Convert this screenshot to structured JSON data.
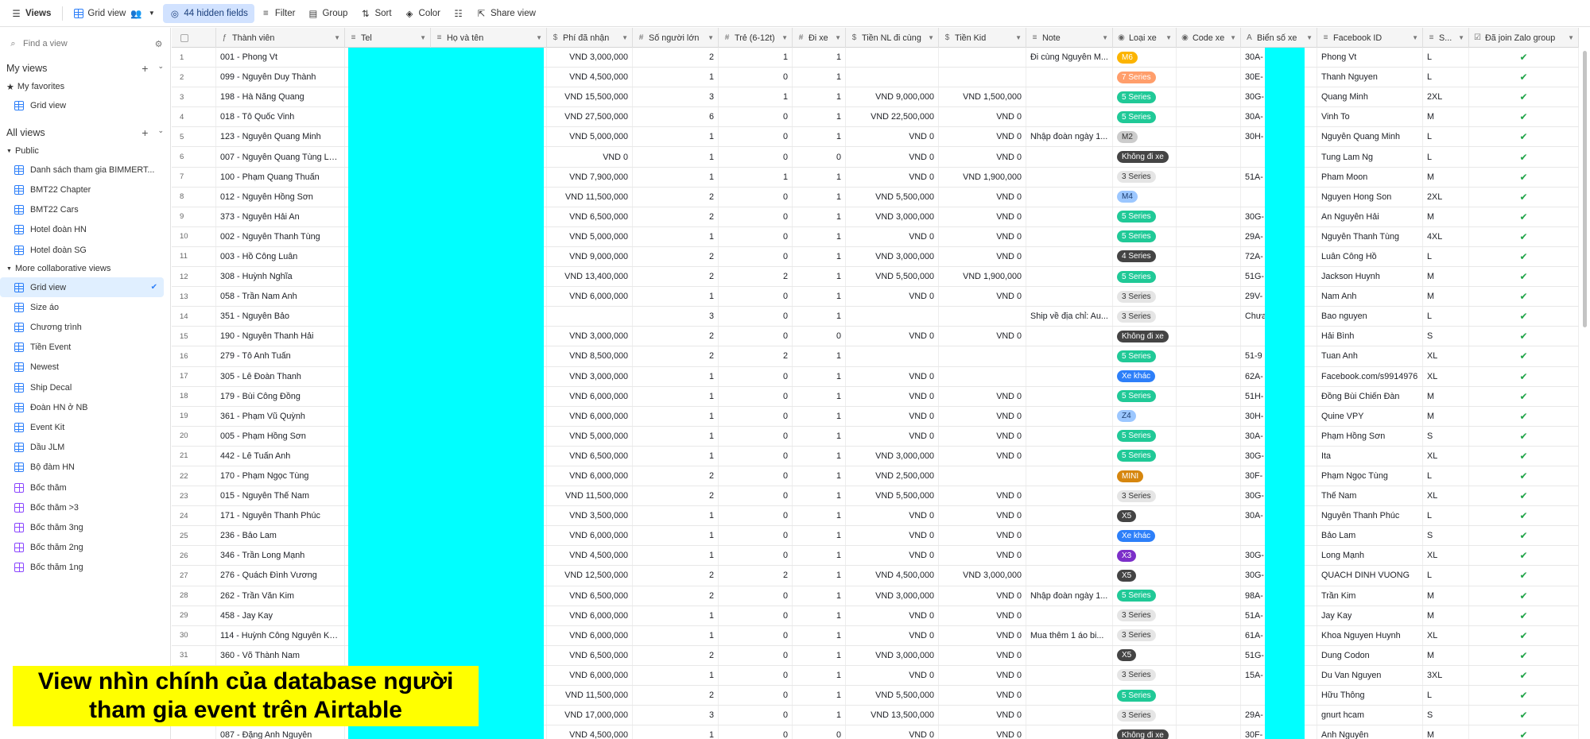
{
  "toolbar": {
    "views_label": "Views",
    "view_name": "Grid view",
    "hidden_fields": "44 hidden fields",
    "filter": "Filter",
    "group": "Group",
    "sort": "Sort",
    "color": "Color",
    "share": "Share view"
  },
  "sidebar": {
    "find_placeholder": "Find a view",
    "my_views": "My views",
    "my_favorites": "My favorites",
    "favorites": [
      {
        "label": "Grid view",
        "type": "grid"
      }
    ],
    "all_views": "All views",
    "public": "Public",
    "public_views": [
      {
        "label": "Danh sách tham gia BIMMERT...",
        "type": "grid"
      },
      {
        "label": "BMT22 Chapter",
        "type": "grid"
      },
      {
        "label": "BMT22 Cars",
        "type": "grid"
      },
      {
        "label": "Hotel đoàn HN",
        "type": "grid"
      },
      {
        "label": "Hotel đoàn SG",
        "type": "grid"
      }
    ],
    "more_collab": "More collaborative views",
    "collab_views": [
      {
        "label": "Grid view",
        "type": "grid",
        "active": true
      },
      {
        "label": "Size áo",
        "type": "grid"
      },
      {
        "label": "Chương trình",
        "type": "grid"
      },
      {
        "label": "Tiền Event",
        "type": "grid"
      },
      {
        "label": "Newest",
        "type": "grid"
      },
      {
        "label": "Ship Decal",
        "type": "grid"
      },
      {
        "label": "Đoàn HN ở NB",
        "type": "grid"
      },
      {
        "label": "Event Kit",
        "type": "grid"
      },
      {
        "label": "Dầu JLM",
        "type": "grid"
      },
      {
        "label": "Bộ đàm HN",
        "type": "grid"
      },
      {
        "label": "Bốc thăm",
        "type": "gallery"
      },
      {
        "label": "Bốc thăm >3",
        "type": "gallery"
      },
      {
        "label": "Bốc thăm 3ng",
        "type": "gallery"
      },
      {
        "label": "Bốc thăm 2ng",
        "type": "gallery"
      },
      {
        "label": "Bốc thăm 1ng",
        "type": "gallery"
      }
    ]
  },
  "columns": [
    {
      "label": "",
      "key": "chk",
      "width": 56,
      "kind": "idx"
    },
    {
      "label": "Thành viên",
      "key": "member",
      "width": 162,
      "icon": "formula-icon",
      "glyph": "ƒ"
    },
    {
      "label": "Tel",
      "key": "tel",
      "width": 108,
      "icon": "text-icon",
      "glyph": "≡"
    },
    {
      "label": "Họ và tên",
      "key": "fullname",
      "width": 146,
      "icon": "text-icon",
      "glyph": "≡"
    },
    {
      "label": "Phí đã nhận",
      "key": "fee",
      "width": 108,
      "icon": "currency-icon",
      "glyph": "$",
      "num": true
    },
    {
      "label": "Số người lớn",
      "key": "adults",
      "width": 108,
      "icon": "number-icon",
      "glyph": "#",
      "num": true
    },
    {
      "label": "Trẻ (6-12t)",
      "key": "kids",
      "width": 93,
      "icon": "number-icon",
      "glyph": "#",
      "num": true
    },
    {
      "label": "Đi xe",
      "key": "car",
      "width": 67,
      "icon": "number-icon",
      "glyph": "#",
      "num": true
    },
    {
      "label": "Tiền NL đi cùng",
      "key": "adultfee",
      "width": 117,
      "icon": "currency-icon",
      "glyph": "$",
      "num": true
    },
    {
      "label": "Tiền Kid",
      "key": "kidfee",
      "width": 110,
      "icon": "currency-icon",
      "glyph": "$",
      "num": true
    },
    {
      "label": "Note",
      "key": "note",
      "width": 109,
      "icon": "text-icon",
      "glyph": "≡"
    },
    {
      "label": "Loại xe",
      "key": "cartype",
      "width": 80,
      "icon": "select-icon",
      "glyph": "◉"
    },
    {
      "label": "Code xe",
      "key": "code",
      "width": 81,
      "icon": "select-icon",
      "glyph": "◉"
    },
    {
      "label": "Biển số xe",
      "key": "plate",
      "width": 96,
      "icon": "text-icon",
      "glyph": "A"
    },
    {
      "label": "Facebook ID",
      "key": "fb",
      "width": 133,
      "icon": "text-icon",
      "glyph": "≡"
    },
    {
      "label": "S...",
      "key": "size",
      "width": 58,
      "icon": "text-icon",
      "glyph": "≡"
    },
    {
      "label": "Đã join Zalo group",
      "key": "zalo",
      "width": 138,
      "icon": "checkbox-icon",
      "glyph": "☑",
      "check": true
    }
  ],
  "cartype_colors": {
    "M6": [
      "#fcb400",
      "#fff"
    ],
    "7 Series": [
      "#ff9e6b",
      "#fff"
    ],
    "5 Series": [
      "#20c997",
      "#fff"
    ],
    "M2": [
      "#cccccc",
      "#333"
    ],
    "Không đi xe": [
      "#444444",
      "#fff"
    ],
    "3 Series": [
      "#e5e5e5",
      "#333"
    ],
    "M4": [
      "#9cc7ff",
      "#1d3e70"
    ],
    "4 Series": [
      "#444444",
      "#fff"
    ],
    "Xe khác": [
      "#2d7ff9",
      "#fff"
    ],
    "Z4": [
      "#9cc7ff",
      "#1d3e70"
    ],
    "MINI": [
      "#d6860e",
      "#fff"
    ],
    "X5": [
      "#444444",
      "#fff"
    ],
    "X3": [
      "#7c2fc9",
      "#fff"
    ]
  },
  "rows": [
    {
      "idx": "1",
      "member": "001 - Phong Vt",
      "fee": "VND 3,000,000",
      "adults": "2",
      "kids": "1",
      "car": "1",
      "adultfee": "",
      "kidfee": "",
      "note": "Đi cùng Nguyễn M...",
      "cartype": "M6",
      "code": "",
      "plate": "30A-",
      "fb": "Phong Vt",
      "size": "L",
      "zalo": true
    },
    {
      "idx": "2",
      "member": "099 - Nguyễn Duy Thành",
      "fee": "VND 4,500,000",
      "adults": "1",
      "kids": "0",
      "car": "1",
      "adultfee": "",
      "kidfee": "",
      "note": "",
      "cartype": "7 Series",
      "code": "",
      "plate": "30E-",
      "fb": "Thanh Nguyen",
      "size": "L",
      "zalo": true
    },
    {
      "idx": "3",
      "member": "198 - Hà Năng Quang",
      "fee": "VND 15,500,000",
      "adults": "3",
      "kids": "1",
      "car": "1",
      "adultfee": "VND 9,000,000",
      "kidfee": "VND 1,500,000",
      "note": "",
      "cartype": "5 Series",
      "code": "",
      "plate": "30G-",
      "fb": "Quang Minh",
      "size": "2XL",
      "zalo": true
    },
    {
      "idx": "4",
      "member": "018 - Tô Quốc Vinh",
      "fee": "VND 27,500,000",
      "adults": "6",
      "kids": "0",
      "car": "1",
      "adultfee": "VND 22,500,000",
      "kidfee": "VND 0",
      "note": "",
      "cartype": "5 Series",
      "code": "",
      "plate": "30A-",
      "fb": "Vinh To",
      "size": "M",
      "zalo": true
    },
    {
      "idx": "5",
      "member": "123 - Nguyễn Quang Minh",
      "fee": "VND 5,000,000",
      "adults": "1",
      "kids": "0",
      "car": "1",
      "adultfee": "VND 0",
      "kidfee": "VND 0",
      "note": "Nhập đoàn ngày 1...",
      "cartype": "M2",
      "code": "",
      "plate": "30H-",
      "fb": "Nguyễn Quang Minh",
      "size": "L",
      "zalo": true
    },
    {
      "idx": "6",
      "member": "007 - Nguyễn Quang Tùng Lâm",
      "fee": "VND 0",
      "adults": "1",
      "kids": "0",
      "car": "0",
      "adultfee": "VND 0",
      "kidfee": "VND 0",
      "note": "",
      "cartype": "Không đi xe",
      "code": "",
      "plate": "",
      "fb": "Tung Lam Ng",
      "size": "L",
      "zalo": true
    },
    {
      "idx": "7",
      "member": "100 - Phạm Quang Thuấn",
      "fee": "VND 7,900,000",
      "adults": "1",
      "kids": "1",
      "car": "1",
      "adultfee": "VND 0",
      "kidfee": "VND 1,900,000",
      "note": "",
      "cartype": "3 Series",
      "code": "",
      "plate": "51A-",
      "fb": "Pham Moon",
      "size": "M",
      "zalo": true
    },
    {
      "idx": "8",
      "member": "012 - Nguyễn Hồng Sơn",
      "fee": "VND 11,500,000",
      "adults": "2",
      "kids": "0",
      "car": "1",
      "adultfee": "VND 5,500,000",
      "kidfee": "VND 0",
      "note": "",
      "cartype": "M4",
      "code": "",
      "plate": "",
      "fb": "Nguyen Hong Son",
      "size": "2XL",
      "zalo": true
    },
    {
      "idx": "9",
      "member": "373 - Nguyễn Hải An",
      "fee": "VND 6,500,000",
      "adults": "2",
      "kids": "0",
      "car": "1",
      "adultfee": "VND 3,000,000",
      "kidfee": "VND 0",
      "note": "",
      "cartype": "5 Series",
      "code": "",
      "plate": "30G-",
      "fb": "An Nguyễn Hải",
      "size": "M",
      "zalo": true
    },
    {
      "idx": "10",
      "member": "002 - Nguyễn Thanh Tùng",
      "fee": "VND 5,000,000",
      "adults": "1",
      "kids": "0",
      "car": "1",
      "adultfee": "VND 0",
      "kidfee": "VND 0",
      "note": "",
      "cartype": "5 Series",
      "code": "",
      "plate": "29A-",
      "fb": "Nguyễn Thanh Tùng",
      "size": "4XL",
      "zalo": true
    },
    {
      "idx": "11",
      "member": "003 - Hồ Công Luân",
      "fee": "VND 9,000,000",
      "adults": "2",
      "kids": "0",
      "car": "1",
      "adultfee": "VND 3,000,000",
      "kidfee": "VND 0",
      "note": "",
      "cartype": "4 Series",
      "code": "",
      "plate": "72A-",
      "fb": "Luân Công Hồ",
      "size": "L",
      "zalo": true
    },
    {
      "idx": "12",
      "member": "308 - Huỳnh Nghĩa",
      "fee": "VND 13,400,000",
      "adults": "2",
      "kids": "2",
      "car": "1",
      "adultfee": "VND 5,500,000",
      "kidfee": "VND 1,900,000",
      "note": "",
      "cartype": "5 Series",
      "code": "",
      "plate": "51G-",
      "fb": "Jackson Huynh",
      "size": "M",
      "zalo": true
    },
    {
      "idx": "13",
      "member": "058 - Trần Nam Anh",
      "fee": "VND 6,000,000",
      "adults": "1",
      "kids": "0",
      "car": "1",
      "adultfee": "VND 0",
      "kidfee": "VND 0",
      "note": "",
      "cartype": "3 Series",
      "code": "",
      "plate": "29V-",
      "fb": "Nam Anh",
      "size": "M",
      "zalo": true
    },
    {
      "idx": "14",
      "member": "351 - Nguyễn Bảo",
      "fee": "",
      "adults": "3",
      "kids": "0",
      "car": "1",
      "adultfee": "",
      "kidfee": "",
      "note": "Ship về địa chỉ: Au...",
      "cartype": "3 Series",
      "code": "",
      "plate": "Chưa",
      "fb": "Bao nguyen",
      "size": "L",
      "zalo": true
    },
    {
      "idx": "15",
      "member": "190 - Nguyễn Thanh Hải",
      "fee": "VND 3,000,000",
      "adults": "2",
      "kids": "0",
      "car": "0",
      "adultfee": "VND 0",
      "kidfee": "VND 0",
      "note": "",
      "cartype": "Không đi xe",
      "code": "",
      "plate": "",
      "fb": "Hải Bình",
      "size": "S",
      "zalo": true
    },
    {
      "idx": "16",
      "member": "279 - Tô Anh Tuấn",
      "fee": "VND 8,500,000",
      "adults": "2",
      "kids": "2",
      "car": "1",
      "adultfee": "",
      "kidfee": "",
      "note": "",
      "cartype": "5 Series",
      "code": "",
      "plate": "51-9",
      "fb": "Tuan Anh",
      "size": "XL",
      "zalo": true
    },
    {
      "idx": "17",
      "member": "305 - Lê Đoàn Thanh",
      "fee": "VND 3,000,000",
      "adults": "1",
      "kids": "0",
      "car": "1",
      "adultfee": "VND 0",
      "kidfee": "",
      "note": "",
      "cartype": "Xe khác",
      "code": "",
      "plate": "62A-",
      "fb": "Facebook.com/s9914976",
      "size": "XL",
      "zalo": true
    },
    {
      "idx": "18",
      "member": "179 - Bùi Công Đồng",
      "fee": "VND 6,000,000",
      "adults": "1",
      "kids": "0",
      "car": "1",
      "adultfee": "VND 0",
      "kidfee": "VND 0",
      "note": "",
      "cartype": "5 Series",
      "code": "",
      "plate": "51H-",
      "fb": "Đồng Bùi Chiến Đàn",
      "size": "M",
      "zalo": true
    },
    {
      "idx": "19",
      "member": "361 - Phạm Vũ Quỳnh",
      "fee": "VND 6,000,000",
      "adults": "1",
      "kids": "0",
      "car": "1",
      "adultfee": "VND 0",
      "kidfee": "VND 0",
      "note": "",
      "cartype": "Z4",
      "code": "",
      "plate": "30H-",
      "fb": "Quine VPY",
      "size": "M",
      "zalo": true
    },
    {
      "idx": "20",
      "member": "005 - Phạm Hồng Sơn",
      "fee": "VND 5,000,000",
      "adults": "1",
      "kids": "0",
      "car": "1",
      "adultfee": "VND 0",
      "kidfee": "VND 0",
      "note": "",
      "cartype": "5 Series",
      "code": "",
      "plate": "30A-",
      "fb": "Phạm Hồng Sơn",
      "size": "S",
      "zalo": true
    },
    {
      "idx": "21",
      "member": "442 - Lê Tuấn Anh",
      "fee": "VND 6,500,000",
      "adults": "1",
      "kids": "0",
      "car": "1",
      "adultfee": "VND 3,000,000",
      "kidfee": "VND 0",
      "note": "",
      "cartype": "5 Series",
      "code": "",
      "plate": "30G-",
      "fb": "Ita",
      "size": "XL",
      "zalo": true
    },
    {
      "idx": "22",
      "member": "170 - Phạm Ngọc Tùng",
      "fee": "VND 6,000,000",
      "adults": "2",
      "kids": "0",
      "car": "1",
      "adultfee": "VND 2,500,000",
      "kidfee": "",
      "note": "",
      "cartype": "MINI",
      "code": "",
      "plate": "30F-",
      "fb": "Phạm Ngọc Tùng",
      "size": "L",
      "zalo": true
    },
    {
      "idx": "23",
      "member": "015 - Nguyễn Thế Nam",
      "fee": "VND 11,500,000",
      "adults": "2",
      "kids": "0",
      "car": "1",
      "adultfee": "VND 5,500,000",
      "kidfee": "VND 0",
      "note": "",
      "cartype": "3 Series",
      "code": "",
      "plate": "30G-",
      "fb": "Thế Nam",
      "size": "XL",
      "zalo": true
    },
    {
      "idx": "24",
      "member": "171 - Nguyễn Thanh Phúc",
      "fee": "VND 3,500,000",
      "adults": "1",
      "kids": "0",
      "car": "1",
      "adultfee": "VND 0",
      "kidfee": "VND 0",
      "note": "",
      "cartype": "X5",
      "code": "",
      "plate": "30A-",
      "fb": "Nguyễn Thanh Phúc",
      "size": "L",
      "zalo": true
    },
    {
      "idx": "25",
      "member": "236 - Bảo Lam",
      "fee": "VND 6,000,000",
      "adults": "1",
      "kids": "0",
      "car": "1",
      "adultfee": "VND 0",
      "kidfee": "VND 0",
      "note": "",
      "cartype": "Xe khác",
      "code": "",
      "plate": "",
      "fb": "Bảo Lam",
      "size": "S",
      "zalo": true
    },
    {
      "idx": "26",
      "member": "346 - Trần Long Mạnh",
      "fee": "VND 4,500,000",
      "adults": "1",
      "kids": "0",
      "car": "1",
      "adultfee": "VND 0",
      "kidfee": "VND 0",
      "note": "",
      "cartype": "X3",
      "code": "",
      "plate": "30G-",
      "fb": "Long Mạnh",
      "size": "XL",
      "zalo": true
    },
    {
      "idx": "27",
      "member": "276 - Quách Đình Vương",
      "fee": "VND 12,500,000",
      "adults": "2",
      "kids": "2",
      "car": "1",
      "adultfee": "VND 4,500,000",
      "kidfee": "VND 3,000,000",
      "note": "",
      "cartype": "X5",
      "code": "",
      "plate": "30G-",
      "fb": "QUACH DINH VUONG",
      "size": "L",
      "zalo": true
    },
    {
      "idx": "28",
      "member": "262 - Trần Văn Kim",
      "fee": "VND 6,500,000",
      "adults": "2",
      "kids": "0",
      "car": "1",
      "adultfee": "VND 3,000,000",
      "kidfee": "VND 0",
      "note": "Nhập đoàn ngày 1...",
      "cartype": "5 Series",
      "code": "",
      "plate": "98A-",
      "fb": "Trần Kim",
      "size": "M",
      "zalo": true
    },
    {
      "idx": "29",
      "member": "458 - Jay Kay",
      "fee": "VND 6,000,000",
      "adults": "1",
      "kids": "0",
      "car": "1",
      "adultfee": "VND 0",
      "kidfee": "VND 0",
      "note": "",
      "cartype": "3 Series",
      "code": "",
      "plate": "51A-",
      "fb": "Jay Kay",
      "size": "M",
      "zalo": true
    },
    {
      "idx": "30",
      "member": "114 - Huỳnh Công Nguyên Khoa",
      "fee": "VND 6,000,000",
      "adults": "1",
      "kids": "0",
      "car": "1",
      "adultfee": "VND 0",
      "kidfee": "VND 0",
      "note": "Mua thêm 1 áo bi...",
      "cartype": "3 Series",
      "code": "",
      "plate": "61A-",
      "fb": "Khoa Nguyen Huynh",
      "size": "XL",
      "zalo": true
    },
    {
      "idx": "31",
      "member": "360 - Võ Thành Nam",
      "fee": "VND 6,500,000",
      "adults": "2",
      "kids": "0",
      "car": "1",
      "adultfee": "VND 3,000,000",
      "kidfee": "VND 0",
      "note": "",
      "cartype": "X5",
      "code": "",
      "plate": "51G-",
      "fb": "Dung Codon",
      "size": "M",
      "zalo": true
    },
    {
      "idx": "32",
      "member": "",
      "fee": "VND 6,000,000",
      "adults": "1",
      "kids": "0",
      "car": "1",
      "adultfee": "VND 0",
      "kidfee": "VND 0",
      "note": "",
      "cartype": "3 Series",
      "code": "",
      "plate": "15A-",
      "fb": "Du Van Nguyen",
      "size": "3XL",
      "zalo": true
    },
    {
      "idx": "33",
      "member": "",
      "fee": "VND 11,500,000",
      "adults": "2",
      "kids": "0",
      "car": "1",
      "adultfee": "VND 5,500,000",
      "kidfee": "VND 0",
      "note": "",
      "cartype": "5 Series",
      "code": "",
      "plate": "",
      "fb": "Hữu Thông",
      "size": "L",
      "zalo": true
    },
    {
      "idx": "34",
      "member": "",
      "fee": "VND 17,000,000",
      "adults": "3",
      "kids": "0",
      "car": "1",
      "adultfee": "VND 13,500,000",
      "kidfee": "VND 0",
      "note": "",
      "cartype": "3 Series",
      "code": "",
      "plate": "29A-",
      "fb": "gnurt hcam",
      "size": "S",
      "zalo": true
    },
    {
      "idx": "",
      "member": "087 - Đặng Anh Nguyên",
      "fee": "VND 4,500,000",
      "adults": "1",
      "kids": "0",
      "car": "0",
      "adultfee": "VND 0",
      "kidfee": "VND 0",
      "note": "",
      "cartype": "Không đi xe",
      "code": "",
      "plate": "30F-",
      "fb": "Anh Nguyên",
      "size": "M",
      "zalo": true
    }
  ],
  "caption": "View nhìn chính của database người tham gia event trên Airtable",
  "colors": {
    "redaction": "#00ffff",
    "caption_bg": "#ffff00",
    "accent": "#2d7ff9",
    "check": "#1fa347"
  }
}
